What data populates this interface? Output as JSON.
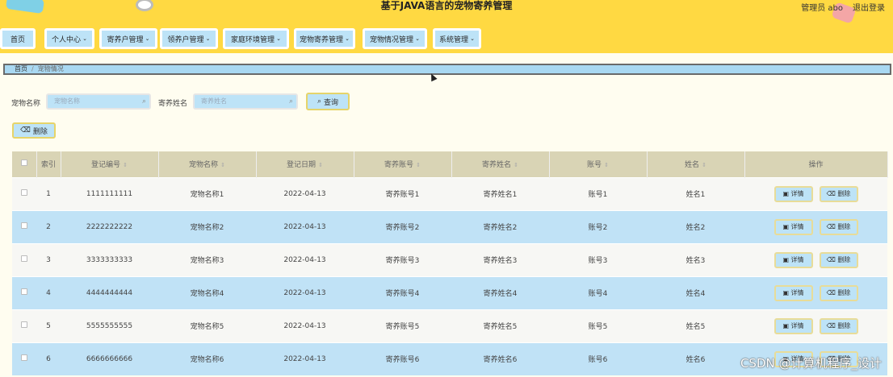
{
  "header": {
    "title": "基于JAVA语言的宠物寄养管理",
    "user_text": "管理员 abo",
    "logout_label": "退出登录"
  },
  "nav": {
    "items": [
      {
        "label": "首页",
        "has_chevron": false
      },
      {
        "label": "个人中心",
        "has_chevron": true
      },
      {
        "label": "寄养户管理",
        "has_chevron": true
      },
      {
        "label": "领养户管理",
        "has_chevron": true
      },
      {
        "label": "家庭环境管理",
        "has_chevron": true
      },
      {
        "label": "宠物寄养管理",
        "has_chevron": true
      },
      {
        "label": "宠物情况管理",
        "has_chevron": true
      },
      {
        "label": "系统管理",
        "has_chevron": true
      }
    ]
  },
  "breadcrumb": {
    "home": "首页",
    "separator": "/",
    "current": "宠物情况"
  },
  "search": {
    "pet_name_label": "宠物名称",
    "pet_name_placeholder": "宠物名称",
    "foster_name_label": "寄养姓名",
    "foster_name_placeholder": "寄养姓名",
    "query_label": "查询"
  },
  "toolbar": {
    "delete_label": "删除"
  },
  "table": {
    "headers": [
      "索引",
      "登记编号",
      "宠物名称",
      "登记日期",
      "寄养账号",
      "寄养姓名",
      "账号",
      "姓名",
      "操作"
    ],
    "detail_label": "详情",
    "delete_label": "删除",
    "rows": [
      {
        "index": "1",
        "reg_no": "1111111111",
        "pet_name": "宠物名称1",
        "date": "2022-04-13",
        "foster_account": "寄养账号1",
        "foster_name": "寄养姓名1",
        "account": "账号1",
        "name": "姓名1"
      },
      {
        "index": "2",
        "reg_no": "2222222222",
        "pet_name": "宠物名称2",
        "date": "2022-04-13",
        "foster_account": "寄养账号2",
        "foster_name": "寄养姓名2",
        "account": "账号2",
        "name": "姓名2"
      },
      {
        "index": "3",
        "reg_no": "3333333333",
        "pet_name": "宠物名称3",
        "date": "2022-04-13",
        "foster_account": "寄养账号3",
        "foster_name": "寄养姓名3",
        "account": "账号3",
        "name": "姓名3"
      },
      {
        "index": "4",
        "reg_no": "4444444444",
        "pet_name": "宠物名称4",
        "date": "2022-04-13",
        "foster_account": "寄养账号4",
        "foster_name": "寄养姓名4",
        "account": "账号4",
        "name": "姓名4"
      },
      {
        "index": "5",
        "reg_no": "5555555555",
        "pet_name": "宠物名称5",
        "date": "2022-04-13",
        "foster_account": "寄养账号5",
        "foster_name": "寄养姓名5",
        "account": "账号5",
        "name": "姓名5"
      },
      {
        "index": "6",
        "reg_no": "6666666666",
        "pet_name": "宠物名称6",
        "date": "2022-04-13",
        "foster_account": "寄养账号6",
        "foster_name": "寄养姓名6",
        "account": "账号6",
        "name": "姓名6"
      }
    ]
  },
  "watermark": "CSDN @计算机程序_设计",
  "colors": {
    "header_bg": "#ffd942",
    "button_bg": "#bde3f7",
    "row_alt": "#c0e2f6",
    "table_head": "#d9d4b5"
  }
}
